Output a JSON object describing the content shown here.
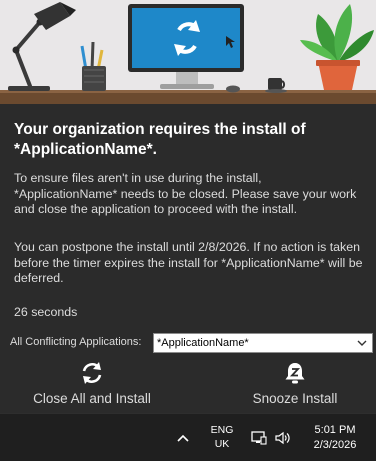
{
  "dialog": {
    "heading": "Your organization requires the install of *ApplicationName*.",
    "paragraph1": "To ensure files aren't in use during the install, *ApplicationName* needs to be closed. Please save your work and close the application to proceed with the install.",
    "paragraph2": "You can postpone the install until 2/8/2026. If no action is taken before the timer expires the install for *ApplicationName* will be deferred.",
    "countdown": "26 seconds",
    "conflicting_label": "All Conflicting Applications:",
    "conflicting_selected": "*ApplicationName*",
    "close_all_label": "Close All and Install",
    "snooze_label": "Snooze Install",
    "close_all_icon": "refresh-icon",
    "snooze_icon": "bell-snooze-icon"
  },
  "banner": {
    "illustration": "desk-with-monitor-lamp-plant",
    "monitor_icon": "refresh-icon"
  },
  "taskbar": {
    "lang_line1": "ENG",
    "lang_line2": "UK",
    "time": "5:01 PM",
    "date": "2/3/2026",
    "tray_icon": "chevron-up-icon",
    "network_icon": "network-icon",
    "volume_icon": "volume-icon"
  },
  "colors": {
    "background": "#2b2b2b",
    "taskbar": "#1f1f1f",
    "monitor_screen": "#1e88c9",
    "desk": "#6b4a2f",
    "text": "#dcdcdc"
  }
}
